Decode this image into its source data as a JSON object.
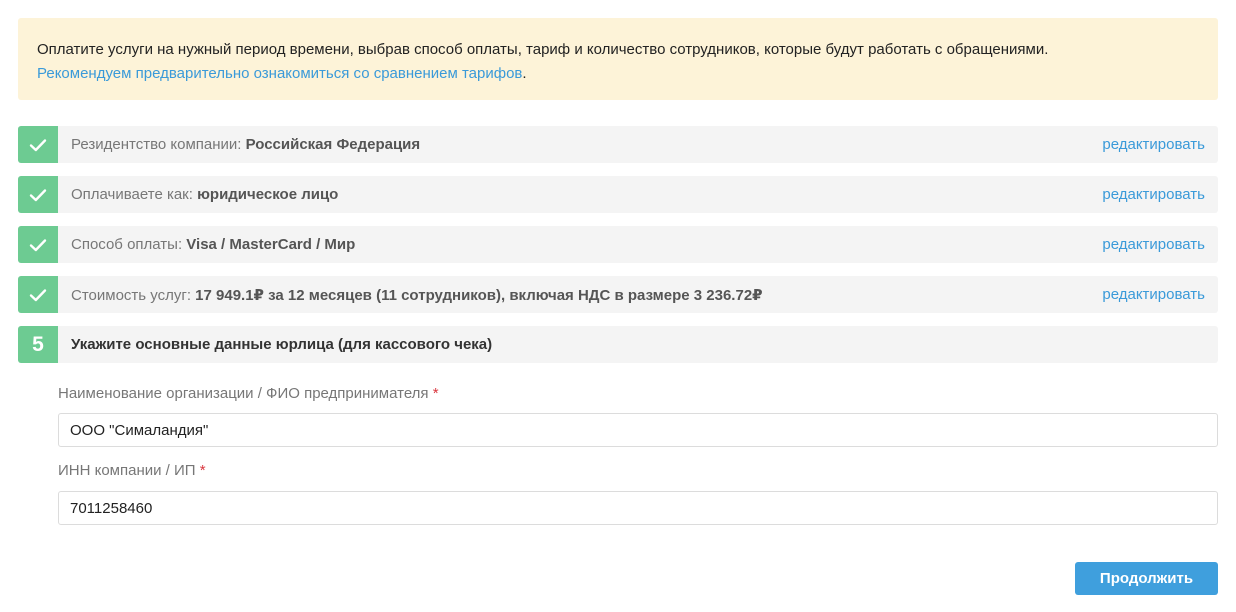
{
  "notice": {
    "text": "Оплатите услуги на нужный период времени, выбрав способ оплаты, тариф и количество сотрудников, которые будут работать с обращениями.",
    "link": "Рекомендуем предварительно ознакомиться со сравнением тарифов",
    "link_suffix": "."
  },
  "steps": [
    {
      "label": "Резидентство компании:",
      "value": "Российская Федерация",
      "edit": "редактировать",
      "status": "done"
    },
    {
      "label": "Оплачиваете как:",
      "value": "юридическое лицо",
      "edit": "редактировать",
      "status": "done"
    },
    {
      "label": "Способ оплаты:",
      "value": "Visa / MasterCard / Мир",
      "edit": "редактировать",
      "status": "done"
    },
    {
      "label": "Стоимость услуг:",
      "value": "17 949.1₽ за 12 месяцев (11 сотрудников), включая НДС в размере 3 236.72₽",
      "edit": "редактировать",
      "status": "done"
    },
    {
      "number": "5",
      "title": "Укажите основные данные юрлица (для кассового чека)",
      "status": "active"
    }
  ],
  "form": {
    "org_label": "Наименование организации / ФИО предпринимателя",
    "org_value": "ООО \"Сималандия\"",
    "inn_label": "ИНН компании / ИП",
    "inn_value": "7011258460",
    "required_mark": "*"
  },
  "submit_label": "Продолжить",
  "colors": {
    "notice_bg": "#fdf3d8",
    "link": "#3a9ad9",
    "done_badge": "#6dcb92",
    "button": "#3f9fdd",
    "required": "#d9363e"
  },
  "icons": {
    "done": "check-icon"
  }
}
